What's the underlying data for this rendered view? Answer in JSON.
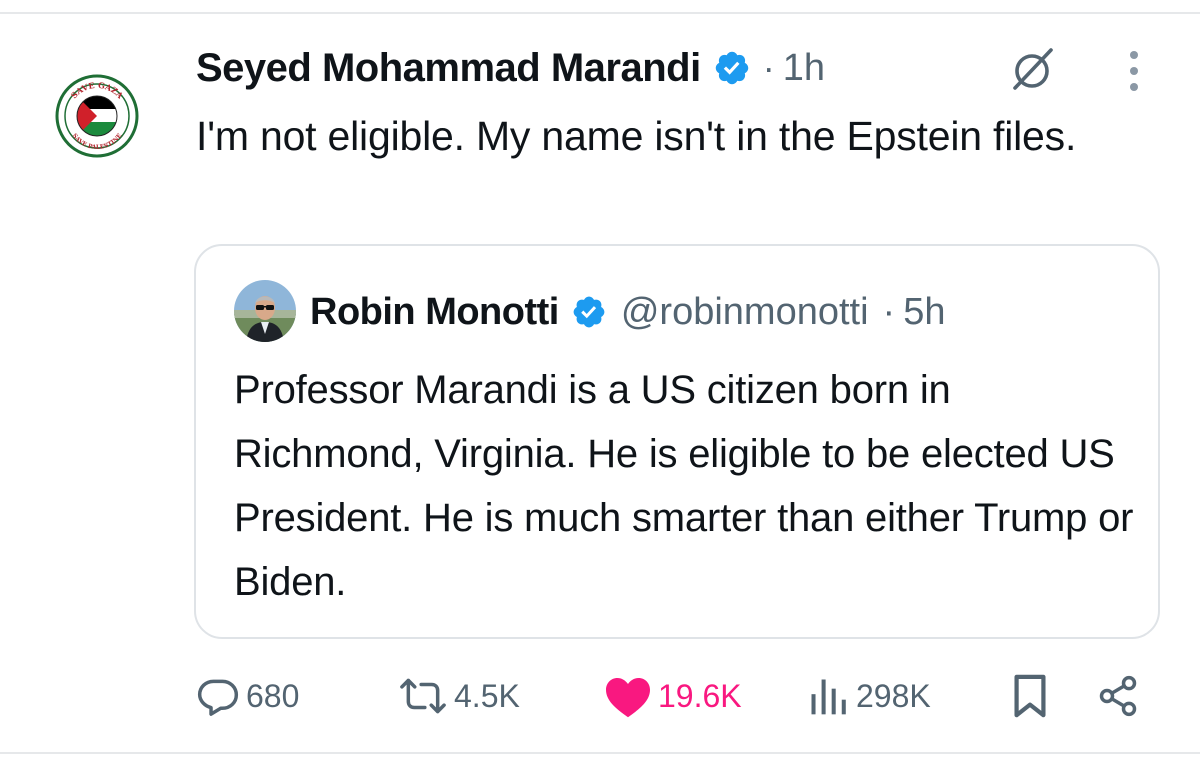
{
  "tweet": {
    "author_name": "Seyed Mohammad Marandi",
    "separator": "·",
    "time": "1h",
    "text": "I'm not eligible. My name isn't in the Epstein files.",
    "avatar_badge": {
      "top_text": "SAVE GAZA",
      "bottom_text": "SAVE PALESTINE"
    },
    "icons": {
      "verified": "verified-badge-icon",
      "grok": "grok-icon",
      "more": "more-options-icon"
    }
  },
  "quote": {
    "author_name": "Robin Monotti",
    "handle": "@robinmonotti",
    "separator": "·",
    "time": "5h",
    "text": "Professor Marandi is a US citizen born in Richmond, Virginia. He is eligible to be elected US President. He is much smarter than either Trump or Biden."
  },
  "actions": {
    "replies": "680",
    "reposts": "4.5K",
    "likes": "19.6K",
    "views": "298K"
  },
  "colors": {
    "verified_blue": "#1d9bf0",
    "like_pink": "#f91880",
    "secondary_text": "#536471",
    "text": "#0f1419"
  }
}
